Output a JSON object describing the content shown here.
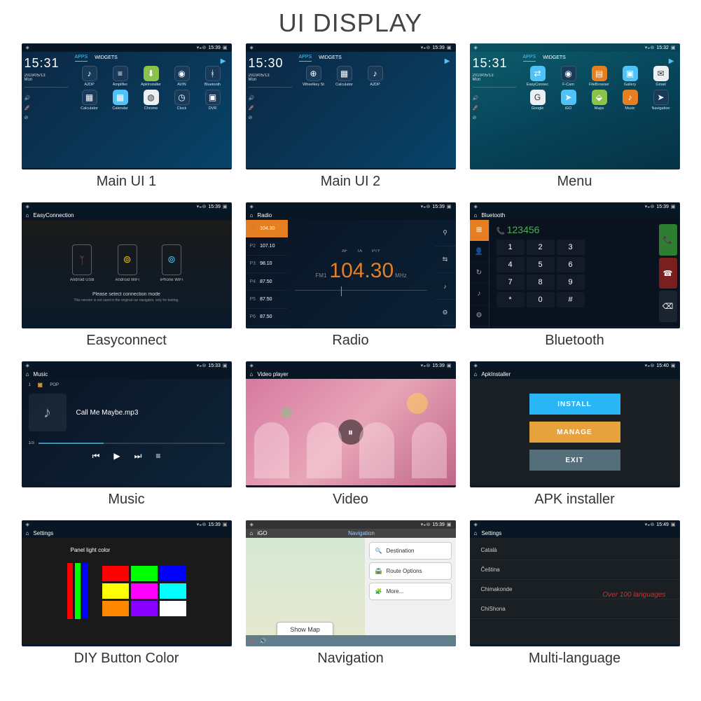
{
  "title": "UI DISPLAY",
  "status": {
    "time": "15:39",
    "time2": "15:32",
    "time3": "15:49",
    "time4": "15:40",
    "time5": "15:33"
  },
  "clock": {
    "time": "15:31",
    "time2": "15:30",
    "date": "2019/05/13",
    "day": "Mon"
  },
  "tabs": {
    "apps": "APPS",
    "widgets": "WIDGETS"
  },
  "apps1": [
    {
      "label": "A2DP",
      "cls": "ic-blue",
      "glyph": "♪"
    },
    {
      "label": "Amplifier",
      "cls": "ic-blue",
      "glyph": "≡"
    },
    {
      "label": "ApkInstaller",
      "cls": "ic-green",
      "glyph": "⬇"
    },
    {
      "label": "AVIN",
      "cls": "ic-blue",
      "glyph": "◉"
    },
    {
      "label": "Bluetooth",
      "cls": "ic-blue",
      "glyph": "ᚼ"
    },
    {
      "label": "Calculator",
      "cls": "ic-blue",
      "glyph": "▦"
    },
    {
      "label": "Calendar",
      "cls": "ic-teal",
      "glyph": "▦"
    },
    {
      "label": "Chrome",
      "cls": "ic-white",
      "glyph": "◍"
    },
    {
      "label": "Clock",
      "cls": "ic-blue",
      "glyph": "◷"
    },
    {
      "label": "DVR",
      "cls": "ic-blue",
      "glyph": "▣"
    }
  ],
  "apps2": [
    {
      "label": "Wheelkey St",
      "cls": "ic-blue",
      "glyph": "⊕"
    },
    {
      "label": "Calculator",
      "cls": "ic-blue",
      "glyph": "▦"
    },
    {
      "label": "A2DP",
      "cls": "ic-blue",
      "glyph": "♪"
    }
  ],
  "apps3": [
    {
      "label": "EasyConnec",
      "cls": "ic-teal",
      "glyph": "⇄"
    },
    {
      "label": "F-Cam",
      "cls": "ic-blue",
      "glyph": "◉"
    },
    {
      "label": "FileBrowser",
      "cls": "ic-orange",
      "glyph": "▤"
    },
    {
      "label": "Gallery",
      "cls": "ic-teal",
      "glyph": "▣"
    },
    {
      "label": "Gmail",
      "cls": "ic-white",
      "glyph": "✉"
    },
    {
      "label": "Google",
      "cls": "ic-white",
      "glyph": "G"
    },
    {
      "label": "iGO",
      "cls": "ic-teal",
      "glyph": "➤"
    },
    {
      "label": "Maps",
      "cls": "ic-green",
      "glyph": "⬙"
    },
    {
      "label": "Music",
      "cls": "ic-orange",
      "glyph": "♪"
    },
    {
      "label": "Navigation",
      "cls": "ic-blue",
      "glyph": "➤"
    }
  ],
  "captions": {
    "c1": "Main UI 1",
    "c2": "Main UI 2",
    "c3": "Menu",
    "c4": "Easyconnect",
    "c5": "Radio",
    "c6": "Bluetooth",
    "c7": "Music",
    "c8": "Video",
    "c9": "APK installer",
    "c10": "DIY Button Color",
    "c11": "Navigation",
    "c12": "Multi-language"
  },
  "ec": {
    "title": "EasyConnection",
    "items": [
      {
        "label": "Android USB",
        "glyph": "ᛉ",
        "color": "#e91e63"
      },
      {
        "label": "Android WiFi",
        "glyph": "⊚",
        "color": "#ffc107"
      },
      {
        "label": "iPhone WiFi",
        "glyph": "⊚",
        "color": "#4fc3f7"
      }
    ],
    "msg": "Please select connection mode",
    "sub": "This version is not used in the original car navigator, only for testing."
  },
  "radio": {
    "title": "Radio",
    "presets": [
      {
        "p": "P1",
        "f": "104.30"
      },
      {
        "p": "P2",
        "f": "107.10"
      },
      {
        "p": "P3",
        "f": "98.10"
      },
      {
        "p": "P4",
        "f": "87.50"
      },
      {
        "p": "P5",
        "f": "87.50"
      },
      {
        "p": "P6",
        "f": "87.50"
      }
    ],
    "tags": [
      "AF",
      "TA",
      "PTY"
    ],
    "band": "FM1",
    "freq": "104.30",
    "unit": "MHz"
  },
  "bt": {
    "title": "Bluetooth",
    "number": "123456",
    "keys": [
      "1",
      "2",
      "3",
      "4",
      "5",
      "6",
      "7",
      "8",
      "9",
      "*",
      "0",
      "#"
    ]
  },
  "music": {
    "title": "Music",
    "tabs": [
      "1",
      "🔀",
      "POP"
    ],
    "track": "Call Me Maybe.mp3",
    "pos": "1/3"
  },
  "video": {
    "title": "Video player"
  },
  "apk": {
    "title": "ApkInstaller",
    "install": "INSTALL",
    "manage": "MANAGE",
    "exit": "EXIT"
  },
  "diy": {
    "title": "Settings",
    "label": "Panel light color",
    "bars": [
      "#ff0000",
      "#00ff00",
      "#0000ff"
    ],
    "swatches": [
      "#ff0000",
      "#00ff00",
      "#0000ff",
      "#ffff00",
      "#ff00ff",
      "#00ffff",
      "#ff8800",
      "#8800ff",
      "#ffffff"
    ]
  },
  "nav": {
    "title": "iGO",
    "subtitle": "Navigation",
    "showmap": "Show Map",
    "items": [
      {
        "icon": "🔍",
        "label": "Destination"
      },
      {
        "icon": "🛣️",
        "label": "Route Options"
      },
      {
        "icon": "🧩",
        "label": "More..."
      }
    ]
  },
  "lang": {
    "title": "Settings",
    "items": [
      "Català",
      "Čeština",
      "Chimakonde",
      "ChiShona"
    ],
    "over": "Over 100 languages"
  }
}
